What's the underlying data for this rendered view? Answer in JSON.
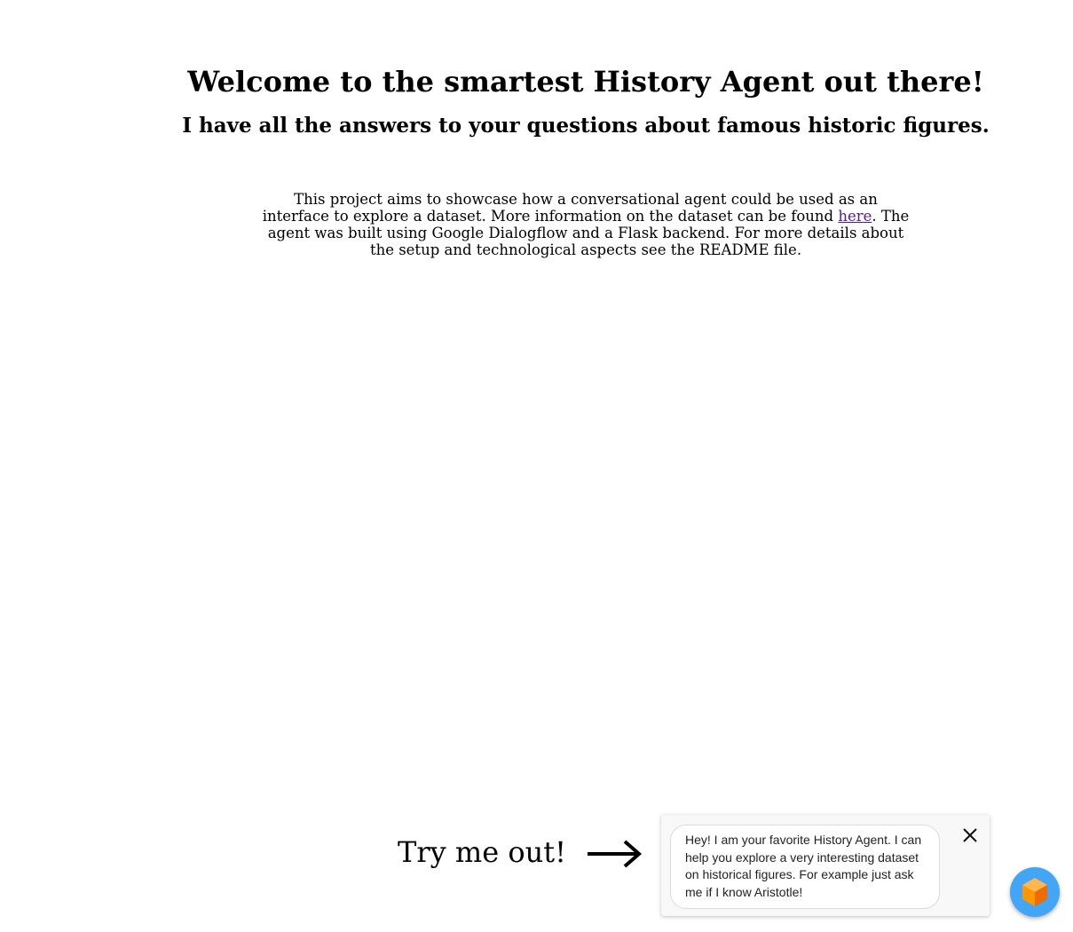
{
  "header": {
    "title": "Welcome to the smartest History Agent out there!",
    "subtitle": "I have all the answers to your questions about famous historic figures."
  },
  "intro": {
    "text_before_link": "This project aims to showcase how a conversational agent could be used as an interface to explore a dataset. More information on the dataset can be found ",
    "link_label": "here",
    "text_after_link": ". The agent was built using Google Dialogflow and a Flask backend. For more details about the setup and technological aspects see the README file."
  },
  "cta": {
    "label": "Try me out!",
    "arrow_icon": "right-arrow-icon"
  },
  "chat": {
    "message": "Hey! I am your favorite History Agent. I can help you explore a very interesting dataset on historical figures. For example just ask me if I know Aristotle!",
    "close_icon": "close-icon",
    "launcher_icon": "dialogflow-cube-icon",
    "launcher_color": "#42a5f5",
    "icon_colors": [
      "#ef6c00",
      "#ff9800",
      "#ffb74d"
    ]
  }
}
